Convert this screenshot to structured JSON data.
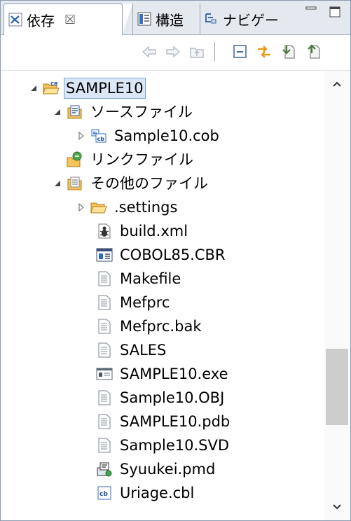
{
  "tabs": [
    {
      "label": "依存",
      "close": "☒",
      "icon": "dependency-icon"
    },
    {
      "label": "構造",
      "icon": "structure-icon"
    },
    {
      "label": "ナビゲー",
      "icon": "navigator-icon"
    }
  ],
  "window_controls": {
    "minimize": "minimize-icon",
    "maximize": "maximize-icon"
  },
  "toolbar": [
    "back-icon",
    "forward-icon",
    "up-folder-icon",
    "collapse-all-icon",
    "link-editor-icon",
    "add-dependency-icon",
    "remove-dependency-icon"
  ],
  "tree": {
    "project": {
      "label": "SAMPLE10",
      "expanded": true,
      "selected": true,
      "icon": "cobol-project-icon"
    },
    "source_folder": {
      "label": "ソースファイル",
      "expanded": true,
      "icon": "source-folder-icon"
    },
    "source_file": {
      "label": "Sample10.cob",
      "expanded": false,
      "icon": "cobol-source-icon"
    },
    "link_folder": {
      "label": "リンクファイル",
      "icon": "link-files-icon"
    },
    "other_folder": {
      "label": "その他のファイル",
      "expanded": true,
      "icon": "other-folder-icon"
    },
    "settings_folder": {
      "label": ".settings",
      "expanded": false,
      "icon": "folder-icon"
    },
    "files": [
      {
        "label": "build.xml",
        "icon": "ant-build-icon"
      },
      {
        "label": "COBOL85.CBR",
        "icon": "config-file-icon"
      },
      {
        "label": "Makefile",
        "icon": "text-file-icon"
      },
      {
        "label": "Mefprc",
        "icon": "text-file-icon"
      },
      {
        "label": "Mefprc.bak",
        "icon": "text-file-icon"
      },
      {
        "label": "SALES",
        "icon": "text-file-icon"
      },
      {
        "label": "SAMPLE10.exe",
        "icon": "executable-icon"
      },
      {
        "label": "Sample10.OBJ",
        "icon": "text-file-icon"
      },
      {
        "label": "SAMPLE10.pdb",
        "icon": "text-file-icon"
      },
      {
        "label": "Sample10.SVD",
        "icon": "text-file-icon"
      },
      {
        "label": "Syuukei.pmd",
        "icon": "program-definition-icon"
      },
      {
        "label": "Uriage.cbl",
        "icon": "cobol-source-icon"
      }
    ]
  },
  "scrollbar": {
    "position": 0.78,
    "visible_fraction": 0.19
  }
}
